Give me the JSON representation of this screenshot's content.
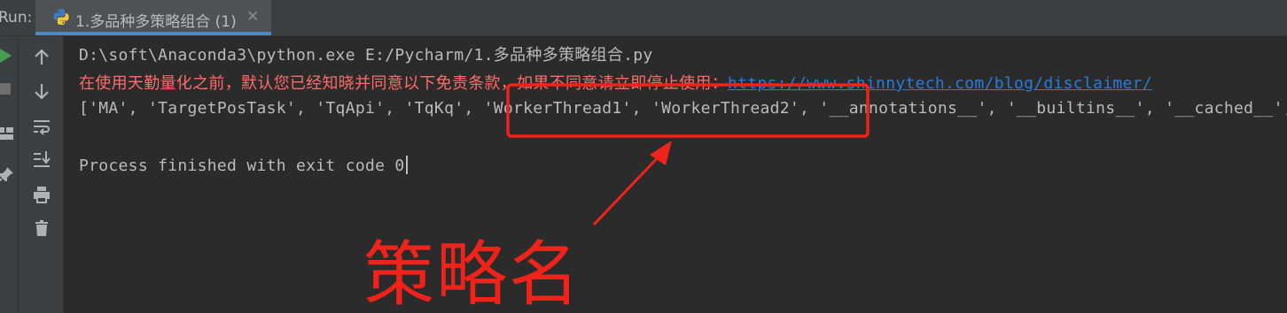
{
  "tabbar": {
    "run_label": "Run:",
    "tab_title": "1.多品种多策略组合 (1)",
    "close_glyph": "✕"
  },
  "left_toolbar": {
    "icons": [
      "run-icon",
      "stop-icon",
      "layout-icon",
      "pin-icon"
    ]
  },
  "console_toolbar": {
    "icons": [
      "up-arrow-icon",
      "down-arrow-icon",
      "soft-wrap-icon",
      "scroll-to-end-icon",
      "print-icon",
      "trash-icon"
    ]
  },
  "console": {
    "command": "D:\\soft\\Anaconda3\\python.exe E:/Pycharm/1.多品种多策略组合.py",
    "disclaimer_text": "在使用天勤量化之前，默认您已经知晓并同意以下免责条款，如果不同意请立即停止使用：",
    "disclaimer_link": "https://www.shinnytech.com/blog/disclaimer/",
    "output_prefix": "['MA', 'TargetPosTask', 'TqApi', 'TqKq', ",
    "output_highlight": "'WorkerThread1', 'WorkerThread2', ",
    "output_suffix": "'__annotations__', '__builtins__', '__cached__',",
    "exit_message": "Process finished with exit code 0"
  },
  "annotation": {
    "label": "策略名",
    "color": "#f0231b"
  },
  "colors": {
    "background": "#2b2b2b",
    "toolbar": "#3c3f41",
    "text": "#bbbbbb",
    "error_text": "#ff6b68",
    "link": "#287bde",
    "tab_accent": "#4a88c7"
  }
}
